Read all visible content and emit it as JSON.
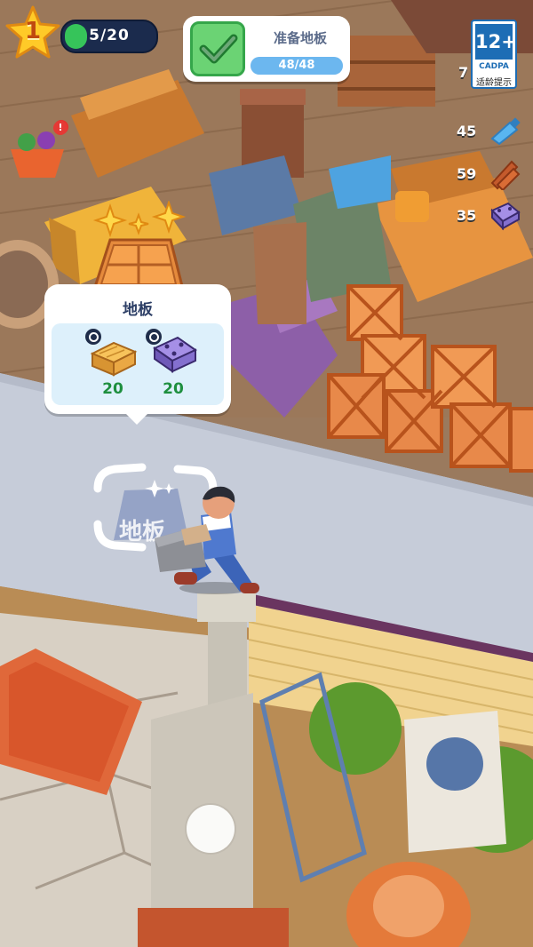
{
  "hud": {
    "level": "1",
    "xp_text": "5/20",
    "xp_progress": 0.25
  },
  "task": {
    "title": "准备地板",
    "progress_text": "48/48",
    "progress": 1.0,
    "icon": "check-icon"
  },
  "age_rating": {
    "age": "12+",
    "brand": "CADPA",
    "note": "适龄提示"
  },
  "resources": [
    {
      "name": "bottle",
      "count": "45",
      "icon": "water-bottle-icon"
    },
    {
      "name": "wood",
      "count": "59",
      "icon": "wood-planks-icon"
    },
    {
      "name": "metal",
      "count": "35",
      "icon": "metal-plate-icon"
    }
  ],
  "resource_partial": "7",
  "floor_popup": {
    "title": "地板",
    "materials": [
      {
        "icon": "wood-block-icon",
        "count": "20"
      },
      {
        "icon": "metal-plate-icon",
        "count": "20"
      }
    ]
  },
  "build_zone": {
    "label": "地板",
    "icon": "floor-tile-icon"
  },
  "colors": {
    "accent_green": "#36c45a",
    "hud_navy": "#1b2b4d",
    "task_blue": "#6cb7ef",
    "count_green": "#1e8f3f"
  }
}
